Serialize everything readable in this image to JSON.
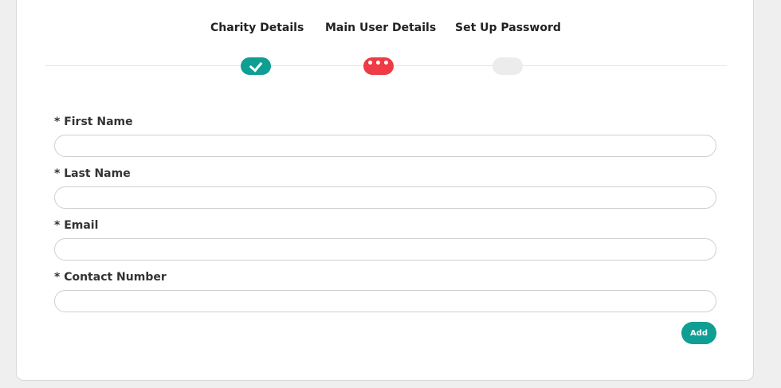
{
  "steps": [
    {
      "label": "Charity Details",
      "status": "completed",
      "icon": "check-icon",
      "color": "#0f9e94"
    },
    {
      "label": "Main User Details",
      "status": "current",
      "indicator": "•••",
      "color": "#ee3b45"
    },
    {
      "label": "Set Up Password",
      "status": "pending",
      "color": "#ececec"
    }
  ],
  "form": {
    "fields": [
      {
        "label": "* First Name",
        "value": "",
        "placeholder": ""
      },
      {
        "label": "* Last Name",
        "value": "",
        "placeholder": ""
      },
      {
        "label": "* Email",
        "value": "",
        "placeholder": ""
      },
      {
        "label": "* Contact Number",
        "value": "",
        "placeholder": ""
      }
    ],
    "add_label": "Add"
  },
  "colors": {
    "accent": "#0f9e94",
    "active": "#ee3b45",
    "background": "#efefef"
  }
}
